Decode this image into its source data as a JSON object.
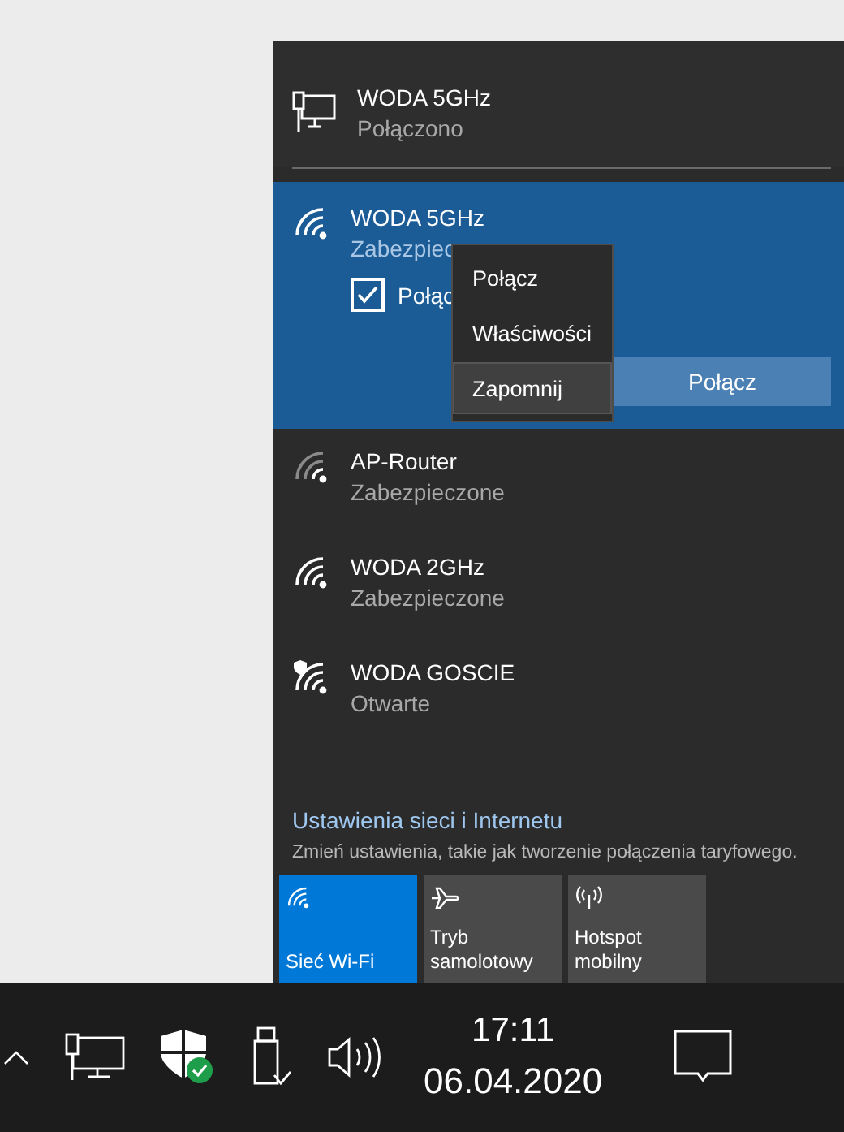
{
  "connected": {
    "name": "WODA 5GHz",
    "status": "Połączono"
  },
  "networks": [
    {
      "name": "WODA 5GHz",
      "status": "Zabezpiec",
      "kind": "strong",
      "selected": true,
      "auto_connect": {
        "label": "Połąc",
        "checked": true
      },
      "button": "Połącz"
    },
    {
      "name": "AP-Router",
      "status": "Zabezpieczone",
      "kind": "weak",
      "selected": false
    },
    {
      "name": "WODA 2GHz",
      "status": "Zabezpieczone",
      "kind": "strong",
      "selected": false
    },
    {
      "name": "WODA GOSCIE",
      "status": "Otwarte",
      "kind": "open",
      "selected": false
    }
  ],
  "context_menu": [
    {
      "label": "Połącz",
      "selected": false
    },
    {
      "label": "Właściwości",
      "selected": false
    },
    {
      "label": "Zapomnij",
      "selected": true
    }
  ],
  "settings": {
    "link": "Ustawienia sieci i Internetu",
    "description": "Zmień ustawienia, takie jak tworzenie połączenia taryfowego."
  },
  "quick_actions": [
    {
      "label": "Sieć Wi-Fi",
      "kind": "wifi",
      "on": true
    },
    {
      "label": "Tryb samolotowy",
      "kind": "airplane",
      "on": false
    },
    {
      "label": "Hotspot mobilny",
      "kind": "hotspot",
      "on": false
    }
  ],
  "taskbar": {
    "time": "17:11",
    "date": "06.04.2020"
  }
}
